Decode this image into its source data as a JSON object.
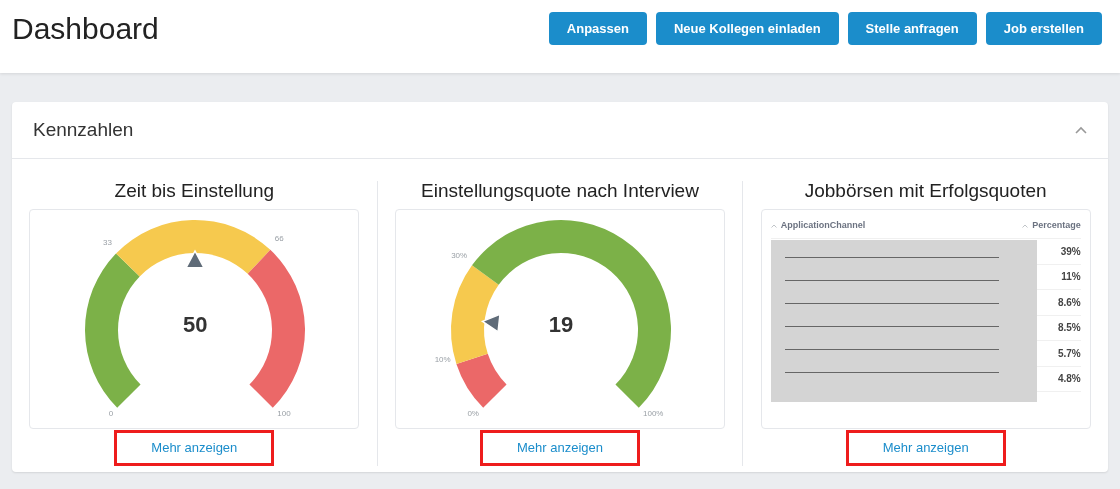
{
  "header": {
    "title": "Dashboard",
    "buttons": [
      "Anpassen",
      "Neue Kollegen einladen",
      "Stelle anfragen",
      "Job erstellen"
    ]
  },
  "section": {
    "title": "Kennzahlen",
    "expanded": true,
    "widgets": [
      {
        "kind": "gauge",
        "title": "Zeit bis Einstellung",
        "value": "50",
        "bands": [
          {
            "color": "#7cb148"
          },
          {
            "color": "#f6c94e"
          },
          {
            "color": "#eb6868"
          }
        ],
        "ticks": [
          "33",
          "66"
        ],
        "scale_min": "0",
        "scale_max": "100",
        "link": {
          "label": "Mehr anzeigen",
          "highlighted": true
        }
      },
      {
        "kind": "gauge",
        "title": "Einstellungsquote nach Interview",
        "value": "19",
        "bands": [
          {
            "color": "#eb6868"
          },
          {
            "color": "#f6c94e"
          },
          {
            "color": "#7cb148"
          }
        ],
        "ticks": [
          "10%",
          "30%"
        ],
        "scale_min": "0%",
        "scale_max": "100%",
        "link": {
          "label": "Mehr anzeigen",
          "highlighted": true
        }
      },
      {
        "kind": "table",
        "title": "Jobbörsen mit Erfolgsquoten",
        "columns": [
          "ApplicationChannel",
          "Percentage"
        ],
        "redacted": true,
        "rows": [
          {
            "percentage": "39%"
          },
          {
            "percentage": "11%"
          },
          {
            "percentage": "8.6%"
          },
          {
            "percentage": "8.5%"
          },
          {
            "percentage": "5.7%"
          },
          {
            "percentage": "4.8%"
          }
        ],
        "link": {
          "label": "Mehr anzeigen",
          "highlighted": true
        }
      }
    ]
  }
}
